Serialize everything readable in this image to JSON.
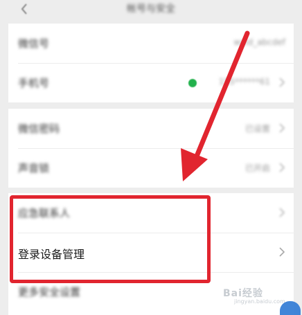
{
  "header": {
    "title": "帐号与安全"
  },
  "group1": {
    "rows": [
      {
        "label": "微信号",
        "value": "wxid_abcdef"
      },
      {
        "label": "手机号",
        "value": "155******61"
      }
    ]
  },
  "group2": {
    "rows": [
      {
        "label": "微信密码",
        "value": "已设置"
      },
      {
        "label": "声音锁",
        "value": "已开启"
      }
    ]
  },
  "group3": {
    "rows": [
      {
        "label": "应急联系人",
        "value": ""
      },
      {
        "label": "登录设备管理",
        "value": ""
      },
      {
        "label": "更多安全设置",
        "value": ""
      }
    ]
  },
  "annotation": {
    "highlight_color": "#e1252f"
  },
  "watermark": {
    "brand": "Bai经验",
    "sub": "jingyan.baidu.com"
  },
  "icons": {
    "back": "chevron-left-icon",
    "row_chevron": "chevron-right-icon",
    "phone_status": "green-dot-icon"
  }
}
